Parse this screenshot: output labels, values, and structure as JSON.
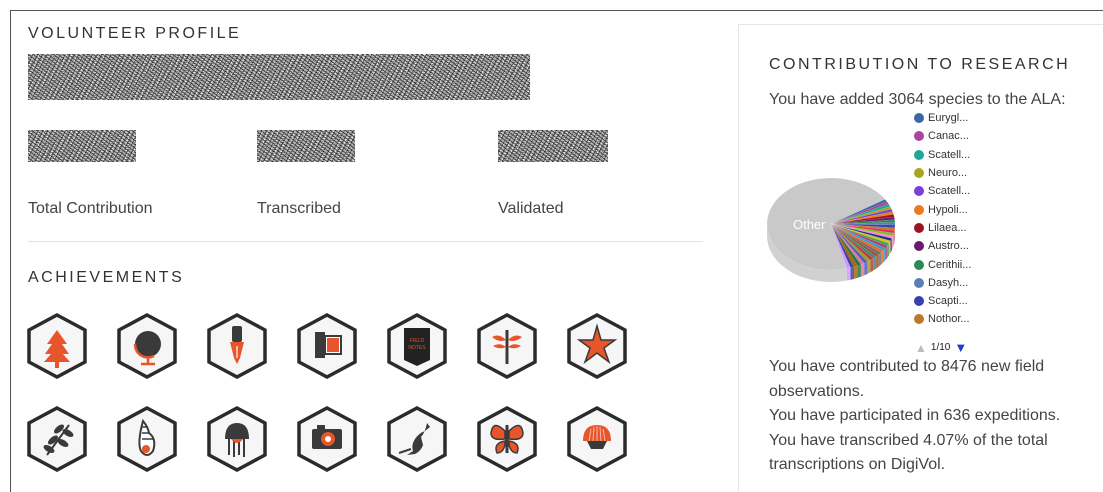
{
  "profile": {
    "title": "VOLUNTEER PROFILE",
    "stats": [
      {
        "label": "Total Contribution"
      },
      {
        "label": "Transcribed"
      },
      {
        "label": "Validated"
      }
    ]
  },
  "achievements": {
    "title": "ACHIEVEMENTS",
    "badges": [
      {
        "name": "tree-icon",
        "row": 0
      },
      {
        "name": "globe-icon",
        "row": 0
      },
      {
        "name": "pen-nib-icon",
        "row": 0
      },
      {
        "name": "film-roll-icon",
        "row": 0
      },
      {
        "name": "field-notes-icon",
        "row": 0,
        "text": "FIELD NOTES"
      },
      {
        "name": "dragonfly-icon",
        "row": 0
      },
      {
        "name": "starfish-icon",
        "row": 0
      },
      {
        "name": "leaf-branch-icon",
        "row": 1
      },
      {
        "name": "seashell-icon",
        "row": 1
      },
      {
        "name": "jellyfish-icon",
        "row": 1
      },
      {
        "name": "camera-icon",
        "row": 1
      },
      {
        "name": "kangaroo-icon",
        "row": 1
      },
      {
        "name": "butterfly-icon",
        "row": 1
      },
      {
        "name": "scallop-shell-icon",
        "row": 1
      }
    ],
    "colors": {
      "accent": "#e8552a",
      "dark": "#3a3a3a",
      "outline": "#2b2b2b"
    }
  },
  "research": {
    "title": "CONTRIBUTION TO RESEARCH",
    "species_text": "You have added 3064 species to the ALA:",
    "pie_other_label": "Other",
    "legend": [
      {
        "label": "Eurygl...",
        "color": "#3d67a8"
      },
      {
        "label": "Canac...",
        "color": "#a8479c"
      },
      {
        "label": "Scatell...",
        "color": "#1ea896"
      },
      {
        "label": "Neuro...",
        "color": "#a7a71f"
      },
      {
        "label": "Scatell...",
        "color": "#7a3fd6"
      },
      {
        "label": "Hypoli...",
        "color": "#ee7a1d"
      },
      {
        "label": "Lilaea...",
        "color": "#9c1420"
      },
      {
        "label": "Austro...",
        "color": "#6b1b6b"
      },
      {
        "label": "Cerithii...",
        "color": "#2e8a55"
      },
      {
        "label": "Dasyh...",
        "color": "#5b7fb3"
      },
      {
        "label": "Scapti...",
        "color": "#3a3eb0"
      },
      {
        "label": "Nothor...",
        "color": "#b87a2b"
      }
    ],
    "pager": "1/10",
    "lines": [
      "You have contributed to 8476 new field observations.",
      "You have participated in 636 expeditions.",
      "You have transcribed 4.07% of the total transcriptions on DigiVol."
    ]
  },
  "chart_data": {
    "type": "pie",
    "title": "",
    "labels": [
      "Other",
      "Eurygl...",
      "Canac...",
      "Scatell...",
      "Neuro...",
      "Scatell...",
      "Hypoli...",
      "Lilaea...",
      "Austro...",
      "Cerithii...",
      "Dasyh...",
      "Scapti...",
      "Nothor..."
    ],
    "values": [
      70,
      2.5,
      2.5,
      2.5,
      2.5,
      2.5,
      2.5,
      2.5,
      2.5,
      2.5,
      2.5,
      2.5,
      2.5
    ],
    "legend_position": "right"
  }
}
